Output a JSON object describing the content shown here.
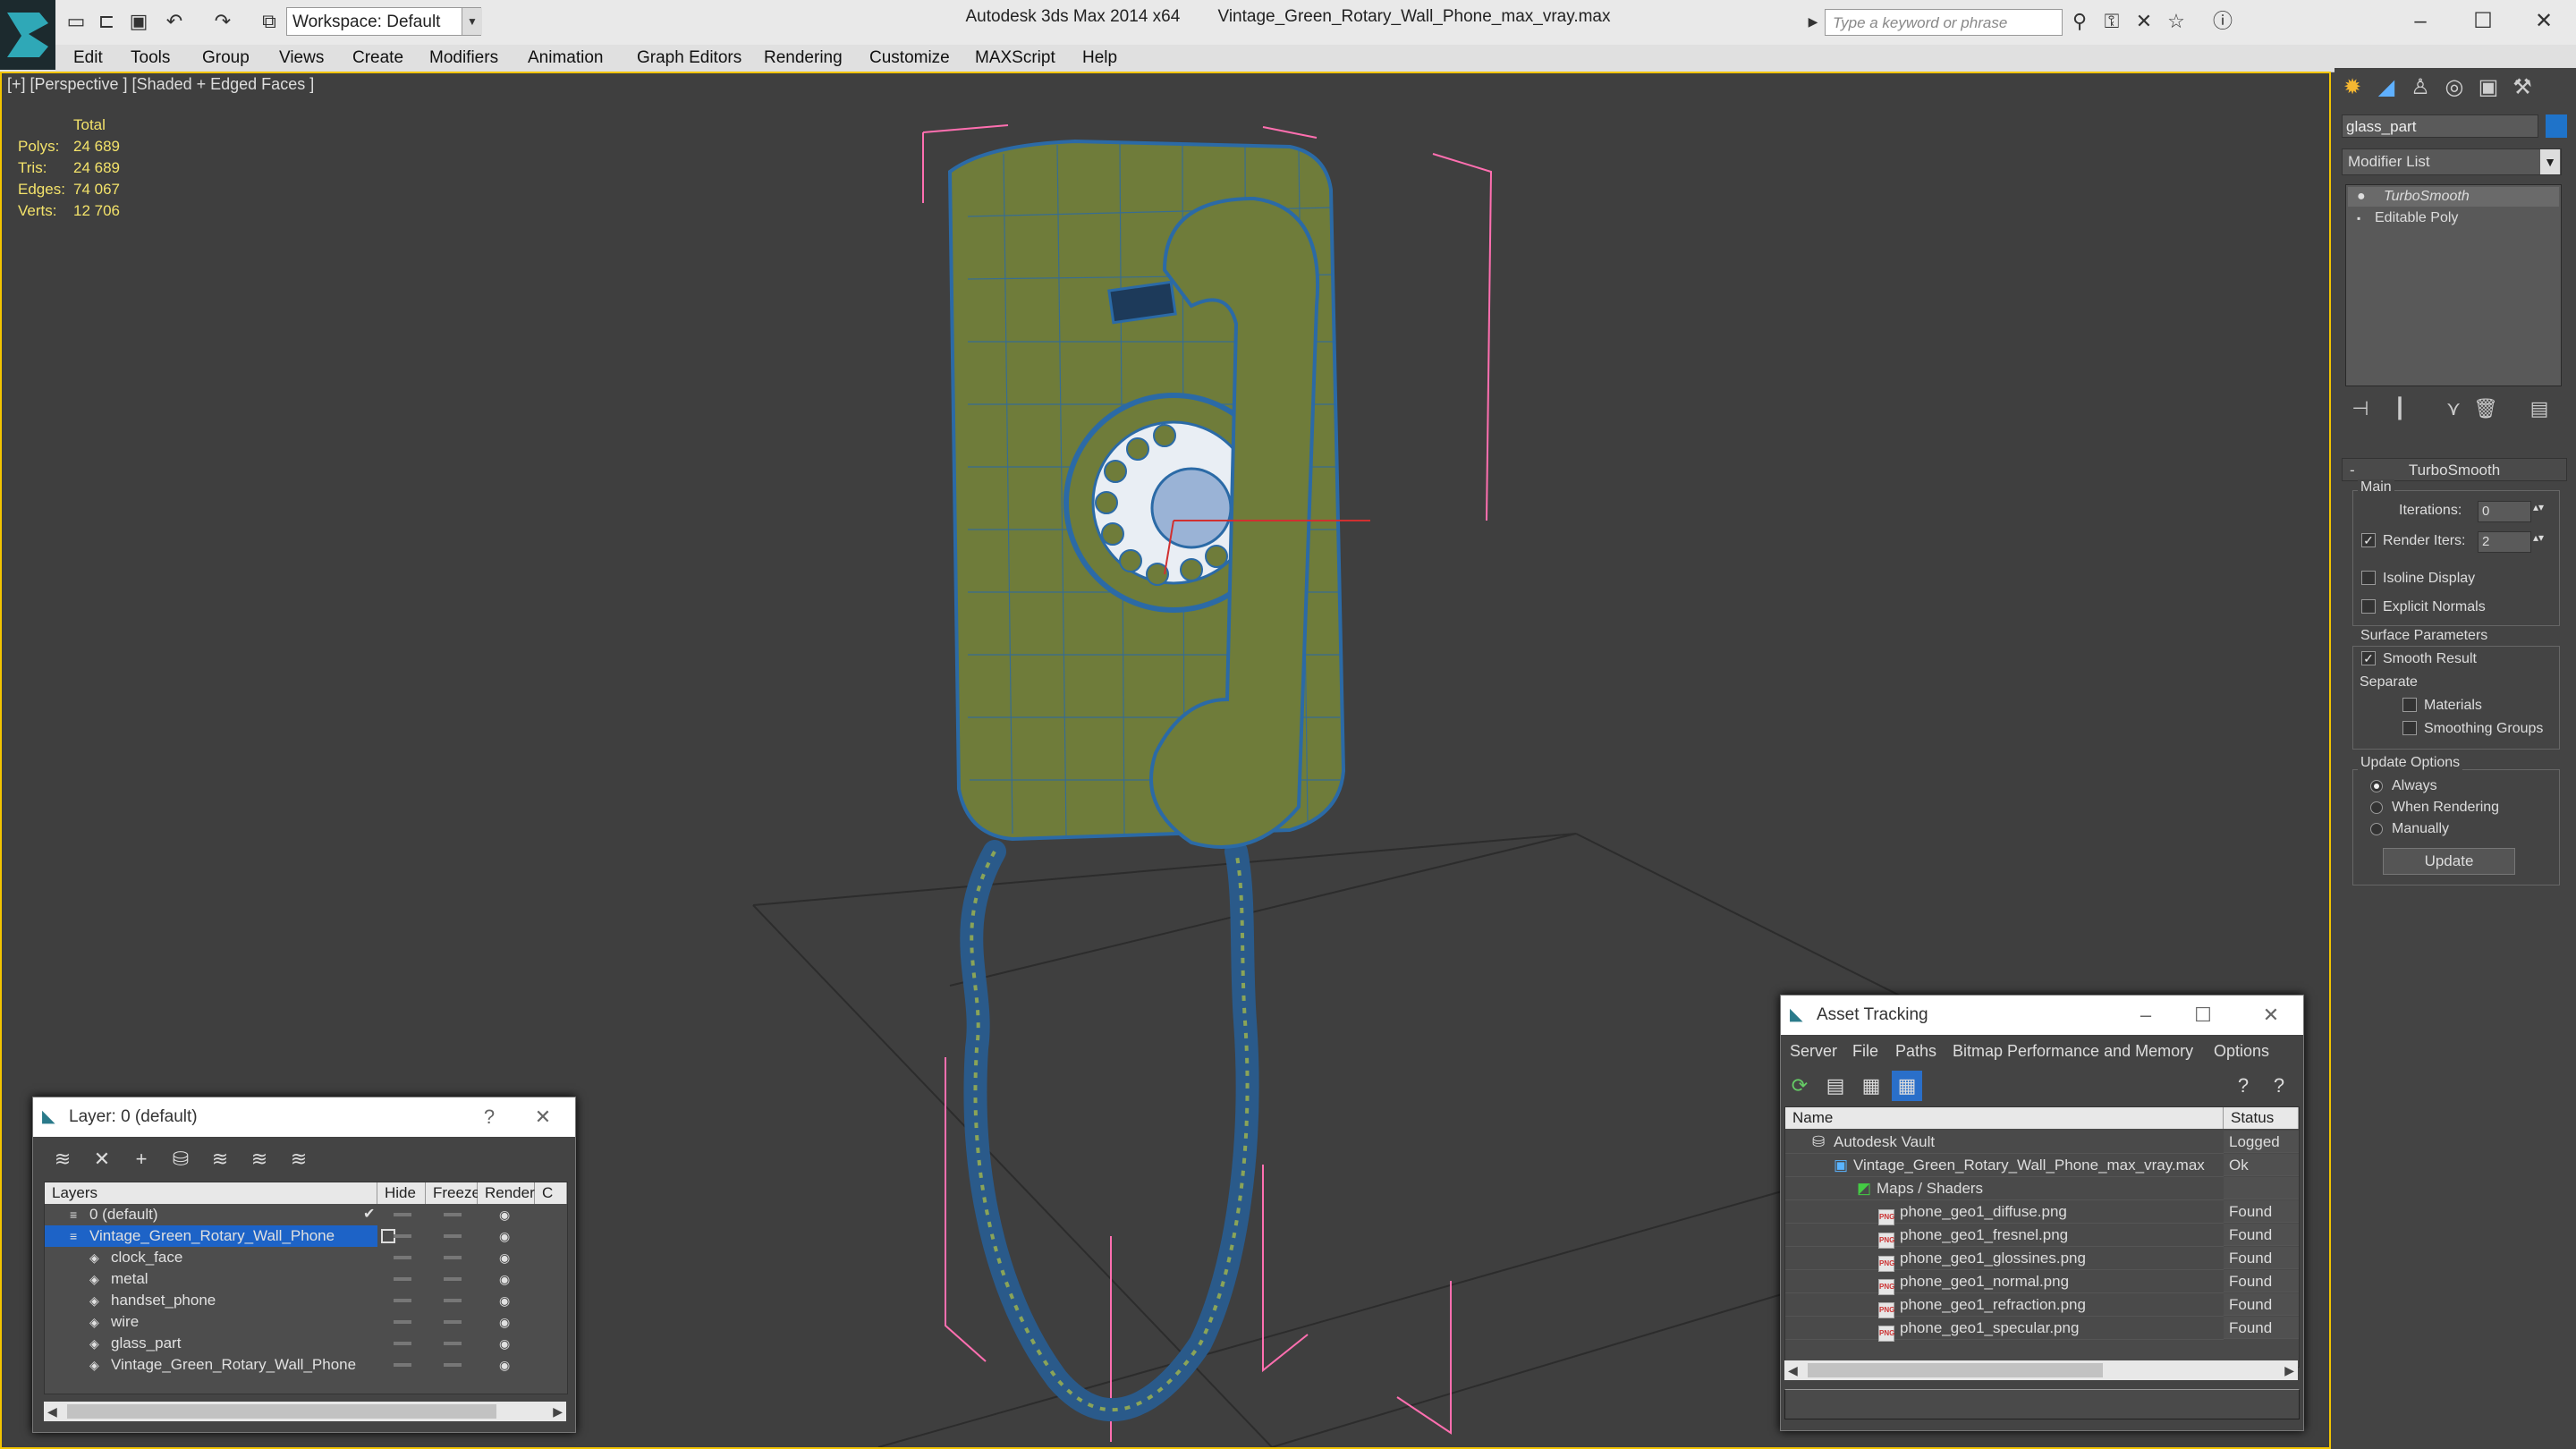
{
  "window": {
    "app": "Autodesk 3ds Max 2014 x64",
    "file": "Vintage_Green_Rotary_Wall_Phone_max_vray.max",
    "workspace": "Workspace: Default",
    "search_placeholder": "Type a keyword or phrase"
  },
  "menu": [
    "Edit",
    "Tools",
    "Group",
    "Views",
    "Create",
    "Modifiers",
    "Animation",
    "Graph Editors",
    "Rendering",
    "Customize",
    "MAXScript",
    "Help"
  ],
  "viewport": {
    "label": "[+] [Perspective ] [Shaded + Edged Faces ]",
    "stats": {
      "header": "Total",
      "rows": [
        {
          "k": "Polys:",
          "v": "24 689"
        },
        {
          "k": "Tris:",
          "v": "24 689"
        },
        {
          "k": "Edges:",
          "v": "74 067"
        },
        {
          "k": "Verts:",
          "v": "12 706"
        }
      ]
    }
  },
  "command_panel": {
    "object_name": "glass_part",
    "modifier_list": "Modifier List",
    "stack": [
      "TurboSmooth",
      "Editable Poly"
    ],
    "rollout_title": "TurboSmooth",
    "main_label": "Main",
    "iterations_label": "Iterations:",
    "iterations_value": "0",
    "render_iters_label": "Render Iters:",
    "render_iters_value": "2",
    "isoline": "Isoline Display",
    "explicit": "Explicit Normals",
    "surface_label": "Surface Parameters",
    "smooth_result": "Smooth Result",
    "separate_label": "Separate",
    "materials": "Materials",
    "smoothing_groups": "Smoothing Groups",
    "update_label": "Update Options",
    "always": "Always",
    "when_rendering": "When Rendering",
    "manually": "Manually",
    "update_button": "Update"
  },
  "layer_dialog": {
    "title": "Layer: 0 (default)",
    "help": "?",
    "columns": [
      "Layers",
      "Hide",
      "Freeze",
      "Render",
      "C"
    ],
    "rows": [
      {
        "name": "0 (default)",
        "indent": 0
      },
      {
        "name": "Vintage_Green_Rotary_Wall_Phone",
        "indent": 0,
        "selected": true
      },
      {
        "name": "clock_face",
        "indent": 1
      },
      {
        "name": "metal",
        "indent": 1
      },
      {
        "name": "handset_phone",
        "indent": 1
      },
      {
        "name": "wire",
        "indent": 1
      },
      {
        "name": "glass_part",
        "indent": 1
      },
      {
        "name": "Vintage_Green_Rotary_Wall_Phone",
        "indent": 1
      }
    ]
  },
  "asset_dialog": {
    "title": "Asset Tracking",
    "menu": [
      "Server",
      "File",
      "Paths",
      "Bitmap Performance and Memory",
      "Options"
    ],
    "columns": [
      "Name",
      "Status"
    ],
    "rows": [
      {
        "name": "Autodesk Vault",
        "status": "Logged",
        "indent": 1
      },
      {
        "name": "Vintage_Green_Rotary_Wall_Phone_max_vray.max",
        "status": "Ok",
        "indent": 2
      },
      {
        "name": "Maps / Shaders",
        "status": "",
        "indent": 3
      },
      {
        "name": "phone_geo1_diffuse.png",
        "status": "Found",
        "indent": 4
      },
      {
        "name": "phone_geo1_fresnel.png",
        "status": "Found",
        "indent": 4
      },
      {
        "name": "phone_geo1_glossines.png",
        "status": "Found",
        "indent": 4
      },
      {
        "name": "phone_geo1_normal.png",
        "status": "Found",
        "indent": 4
      },
      {
        "name": "phone_geo1_refraction.png",
        "status": "Found",
        "indent": 4
      },
      {
        "name": "phone_geo1_specular.png",
        "status": "Found",
        "indent": 4
      }
    ],
    "file_badge": "PNG"
  }
}
